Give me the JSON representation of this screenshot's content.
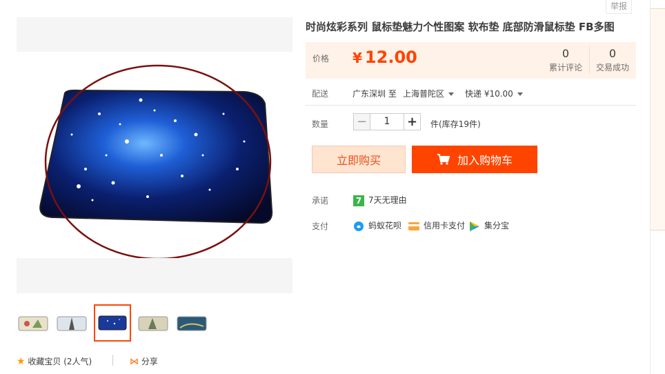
{
  "header": {
    "report_label": "举报"
  },
  "product": {
    "title": "时尚炫彩系列 鼠标垫魅力个性图案 软布垫 底部防滑鼠标垫 FB多图"
  },
  "price": {
    "label": "价格",
    "currency": "¥",
    "value": "12.00",
    "accent_color": "#ff4400"
  },
  "stats": [
    {
      "value": "0",
      "label": "累计评论"
    },
    {
      "value": "0",
      "label": "交易成功"
    }
  ],
  "delivery": {
    "label": "配送",
    "from": "广东深圳 至",
    "to": "上海普陀区",
    "method": "快递 ¥10.00"
  },
  "quantity": {
    "label": "数量",
    "value": "1",
    "stock": "件(库存19件)"
  },
  "actions": {
    "buy_now": "立即购买",
    "add_to_cart": "加入购物车"
  },
  "promise": {
    "label": "承诺",
    "badge": "7",
    "text": "7天无理由"
  },
  "payment": {
    "label": "支付",
    "methods": [
      {
        "name": "蚂蚁花呗",
        "icon": "huabei-icon"
      },
      {
        "name": "信用卡支付",
        "icon": "credit-card-icon"
      },
      {
        "name": "集分宝",
        "icon": "jifenbao-icon"
      }
    ]
  },
  "gallery": {
    "thumbnails": [
      {
        "icon": "thumbnail-image-icon",
        "selected": false
      },
      {
        "icon": "thumbnail-image-icon",
        "selected": false
      },
      {
        "icon": "thumbnail-image-icon",
        "selected": true
      },
      {
        "icon": "thumbnail-image-icon",
        "selected": false
      },
      {
        "icon": "thumbnail-image-icon",
        "selected": false
      }
    ]
  },
  "footer": {
    "favorite": "收藏宝贝",
    "favorite_count": "(2人气)",
    "share": "分享"
  }
}
